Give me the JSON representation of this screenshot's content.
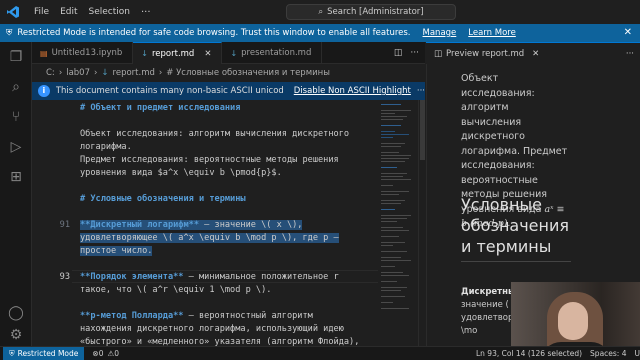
{
  "menu": {
    "file": "File",
    "edit": "Edit",
    "selection": "Selection",
    "more": "···"
  },
  "search": {
    "text": "Search [Administrator]"
  },
  "banner": {
    "message": "Restricted Mode is intended for safe code browsing. Trust this window to enable all features.",
    "manage": "Manage",
    "learn_more": "Learn More"
  },
  "tabs": [
    {
      "label": "Untitled13.ipynb"
    },
    {
      "label": "report.md"
    },
    {
      "label": "presentation.md"
    }
  ],
  "preview_tab": {
    "label": "Preview report.md"
  },
  "breadcrumb": {
    "c": "C:",
    "folder": "lab07",
    "file": "report.md",
    "section": "# Условные обозначения и термины"
  },
  "unicode_warning": {
    "message": "This document contains many non-basic ASCII unicode chara",
    "action": "Disable Non ASCII Highlight"
  },
  "editor": {
    "lines": [
      {
        "n": "",
        "segs": [
          {
            "t": "# Объект и предмет исследования",
            "c": "hd"
          }
        ]
      },
      {
        "n": "",
        "segs": [
          {
            "t": "",
            "c": ""
          }
        ]
      },
      {
        "n": "",
        "segs": [
          {
            "t": "Объект исследования: алгоритм вычисления дискретного",
            "c": ""
          }
        ]
      },
      {
        "n": "",
        "segs": [
          {
            "t": "логарифма.",
            "c": ""
          }
        ]
      },
      {
        "n": "",
        "segs": [
          {
            "t": "Предмет исследования: вероятностные методы решения",
            "c": ""
          }
        ]
      },
      {
        "n": "",
        "segs": [
          {
            "t": "уровнения вида $a^x \\equiv b \\pmod{p}$.",
            "c": ""
          }
        ]
      },
      {
        "n": "",
        "segs": [
          {
            "t": "",
            "c": ""
          }
        ]
      },
      {
        "n": "",
        "segs": [
          {
            "t": "# Условные обозначения и термины",
            "c": "hd"
          }
        ]
      },
      {
        "n": "",
        "segs": [
          {
            "t": "",
            "c": ""
          }
        ]
      },
      {
        "n": "91",
        "segs": [
          {
            "t": "**Дискретный логарифм**",
            "c": "bd sel"
          },
          {
            "t": " — значение \\( x \\),",
            "c": "sel"
          }
        ]
      },
      {
        "n": "",
        "segs": [
          {
            "t": "удовлетворяющее \\( a^x \\equiv b \\mod p \\), где p —",
            "c": "sel"
          }
        ]
      },
      {
        "n": "",
        "segs": [
          {
            "t": "простое число.",
            "c": "sel"
          }
        ]
      },
      {
        "n": "",
        "segs": [
          {
            "t": "",
            "c": ""
          }
        ]
      },
      {
        "n": "93",
        "segs": [
          {
            "t": "**Порядок элемента**",
            "c": "bd"
          },
          {
            "t": " — минимальное положительное r",
            "c": ""
          }
        ]
      },
      {
        "n": "",
        "segs": [
          {
            "t": "такое, что \\( a^r \\equiv 1 \\mod p \\).",
            "c": ""
          }
        ]
      },
      {
        "n": "",
        "segs": [
          {
            "t": "",
            "c": ""
          }
        ]
      },
      {
        "n": "",
        "segs": [
          {
            "t": "**p-метод Полларда**",
            "c": "bd"
          },
          {
            "t": " — вероятностный алгоритм",
            "c": ""
          }
        ]
      },
      {
        "n": "",
        "segs": [
          {
            "t": "нахождения дискретного логарифма, использующий идею",
            "c": ""
          }
        ]
      },
      {
        "n": "",
        "segs": [
          {
            "t": "«быстрого» и «медленного» указателя (алгоритм Флойда),",
            "c": ""
          }
        ]
      }
    ]
  },
  "preview": {
    "p1": "Объект исследования: алгоритм вычисления дискретного логарифма. Предмет исследования: вероятностные методы решения уровнения вида",
    "math": "aˣ ≡ b (mod p).",
    "heading": "Условные обозначения и термины",
    "low_bold": "Дискретны",
    "low_rest": "значение ( x удовлетворяю \\equiv b \\mo"
  },
  "status": {
    "restricted": "Restricted Mode",
    "errors": "0",
    "warnings": "0",
    "position": "Ln 93, Col 14 (126 selected)",
    "spaces": "Spaces: 4",
    "encoding": "U"
  },
  "colors": {
    "accent": "#0078d4",
    "banner": "#0e639c",
    "selection": "#264f78",
    "markdown_heading": "#569cd6"
  }
}
